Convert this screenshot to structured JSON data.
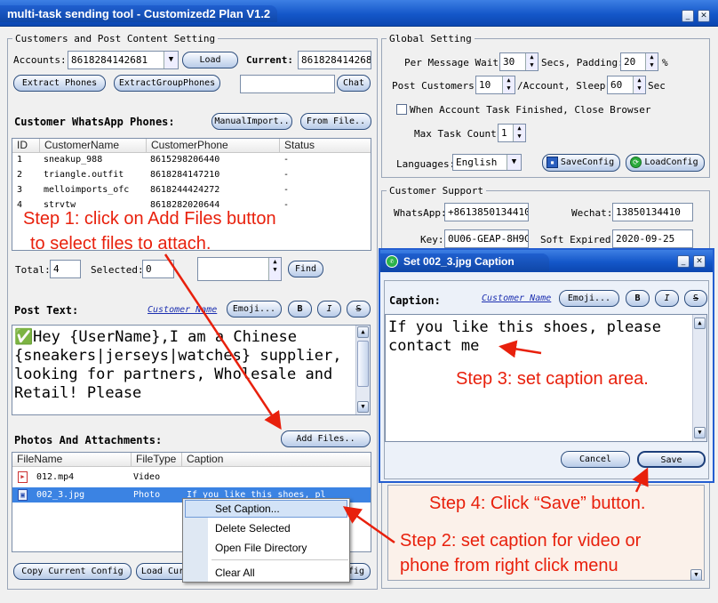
{
  "window": {
    "title": "multi-task sending tool - Customized2 Plan V1.2",
    "minimize": "_",
    "close": "✕"
  },
  "customers": {
    "group_label": "Customers and Post Content Setting",
    "accounts_label": "Accounts:",
    "accounts_value": "8618284142681",
    "load_btn": "Load",
    "current_label": "Current:",
    "current_value": "8618284142681",
    "extract_phones_btn": "Extract Phones",
    "extract_group_btn": "ExtractGroupPhones",
    "chat_btn": "Chat",
    "phones_title": "Customer WhatsApp Phones:",
    "manual_import_btn": "ManualImport..",
    "from_file_btn": "From File..",
    "columns": [
      "ID",
      "CustomerName",
      "CustomerPhone",
      "Status"
    ],
    "rows": [
      {
        "id": "1",
        "name": "sneakup_988",
        "phone": "8615298206440",
        "status": "-"
      },
      {
        "id": "2",
        "name": "triangle.outfit",
        "phone": "8618284147210",
        "status": "-"
      },
      {
        "id": "3",
        "name": "melloimports_ofc",
        "phone": "8618244424272",
        "status": "-"
      },
      {
        "id": "4",
        "name": "strvtw",
        "phone": "8618282020644",
        "status": "-"
      }
    ],
    "total_label": "Total:",
    "total_value": "4",
    "selected_label": "Selected:",
    "selected_value": "0",
    "find_btn": "Find"
  },
  "post": {
    "label": "Post Text:",
    "customer_name_link": "Customer Name",
    "emoji_btn": "Emoji...",
    "bold_btn": "B",
    "italic_btn": "I",
    "strike_btn": "S",
    "text": "✅Hey {UserName},I am a Chinese {sneakers|jerseys|watches} supplier, looking for partners, Wholesale and Retail! Please"
  },
  "attachments": {
    "label": "Photos And Attachments:",
    "add_files_btn": "Add Files..",
    "columns": [
      "FileName",
      "FileType",
      "Caption"
    ],
    "rows": [
      {
        "name": "012.mp4",
        "type": "Video",
        "caption": ""
      },
      {
        "name": "002_3.jpg",
        "type": "Photo",
        "caption": "If you like this shoes, pl"
      }
    ],
    "copy_config_btn": "Copy Current Config",
    "load_config_btn": "Load Cur",
    "right_btn": "fig"
  },
  "global": {
    "group_label": "Global Setting",
    "per_msg_label": "Per Message Wait:",
    "per_msg_value": "30",
    "secs_padding_label": "Secs, Padding:",
    "padding_value": "20",
    "pct": "%",
    "post_customers_label": "Post Customers:",
    "post_customers_value": "10",
    "per_account_label": "/Account, Sleep:",
    "sleep_value": "60",
    "sec_label": "Sec",
    "close_browser_label": "When Account Task Finished, Close Browser",
    "max_task_label": "Max Task Count:",
    "max_task_value": "1",
    "languages_label": "Languages:",
    "language_value": "English",
    "save_config_btn": "SaveConfig",
    "load_config_btn": "LoadConfig"
  },
  "support": {
    "group_label": "Customer Support",
    "whatsapp_label": "WhatsApp:",
    "whatsapp_value": "+8613850134410",
    "wechat_label": "Wechat:",
    "wechat_value": "13850134410",
    "key_label": "Key:",
    "key_value": "0U06-GEAP-8H9G-",
    "expired_label": "Soft Expired:",
    "expired_value": "2020-09-25"
  },
  "dialog": {
    "title": "Set 002_3.jpg Caption",
    "caption_label": "Caption:",
    "customer_name_link": "Customer Name",
    "emoji_btn": "Emoji...",
    "bold_btn": "B",
    "italic_btn": "I",
    "strike_btn": "S",
    "caption_text": "If you like this shoes, please contact me",
    "cancel_btn": "Cancel",
    "save_btn": "Save"
  },
  "context_menu": {
    "items": [
      "Set Caption...",
      "Delete Selected",
      "Open File Directory",
      "Clear All"
    ]
  },
  "annotations": {
    "step1_line1": "Step 1: click on Add Files button",
    "step1_line2": "to select files to attach.",
    "step2_line1": "Step 2: set caption for video or",
    "step2_line2": "phone from right click menu",
    "step3": "Step 3: set caption area.",
    "step4": "Step 4: Click  “Save”  button."
  }
}
